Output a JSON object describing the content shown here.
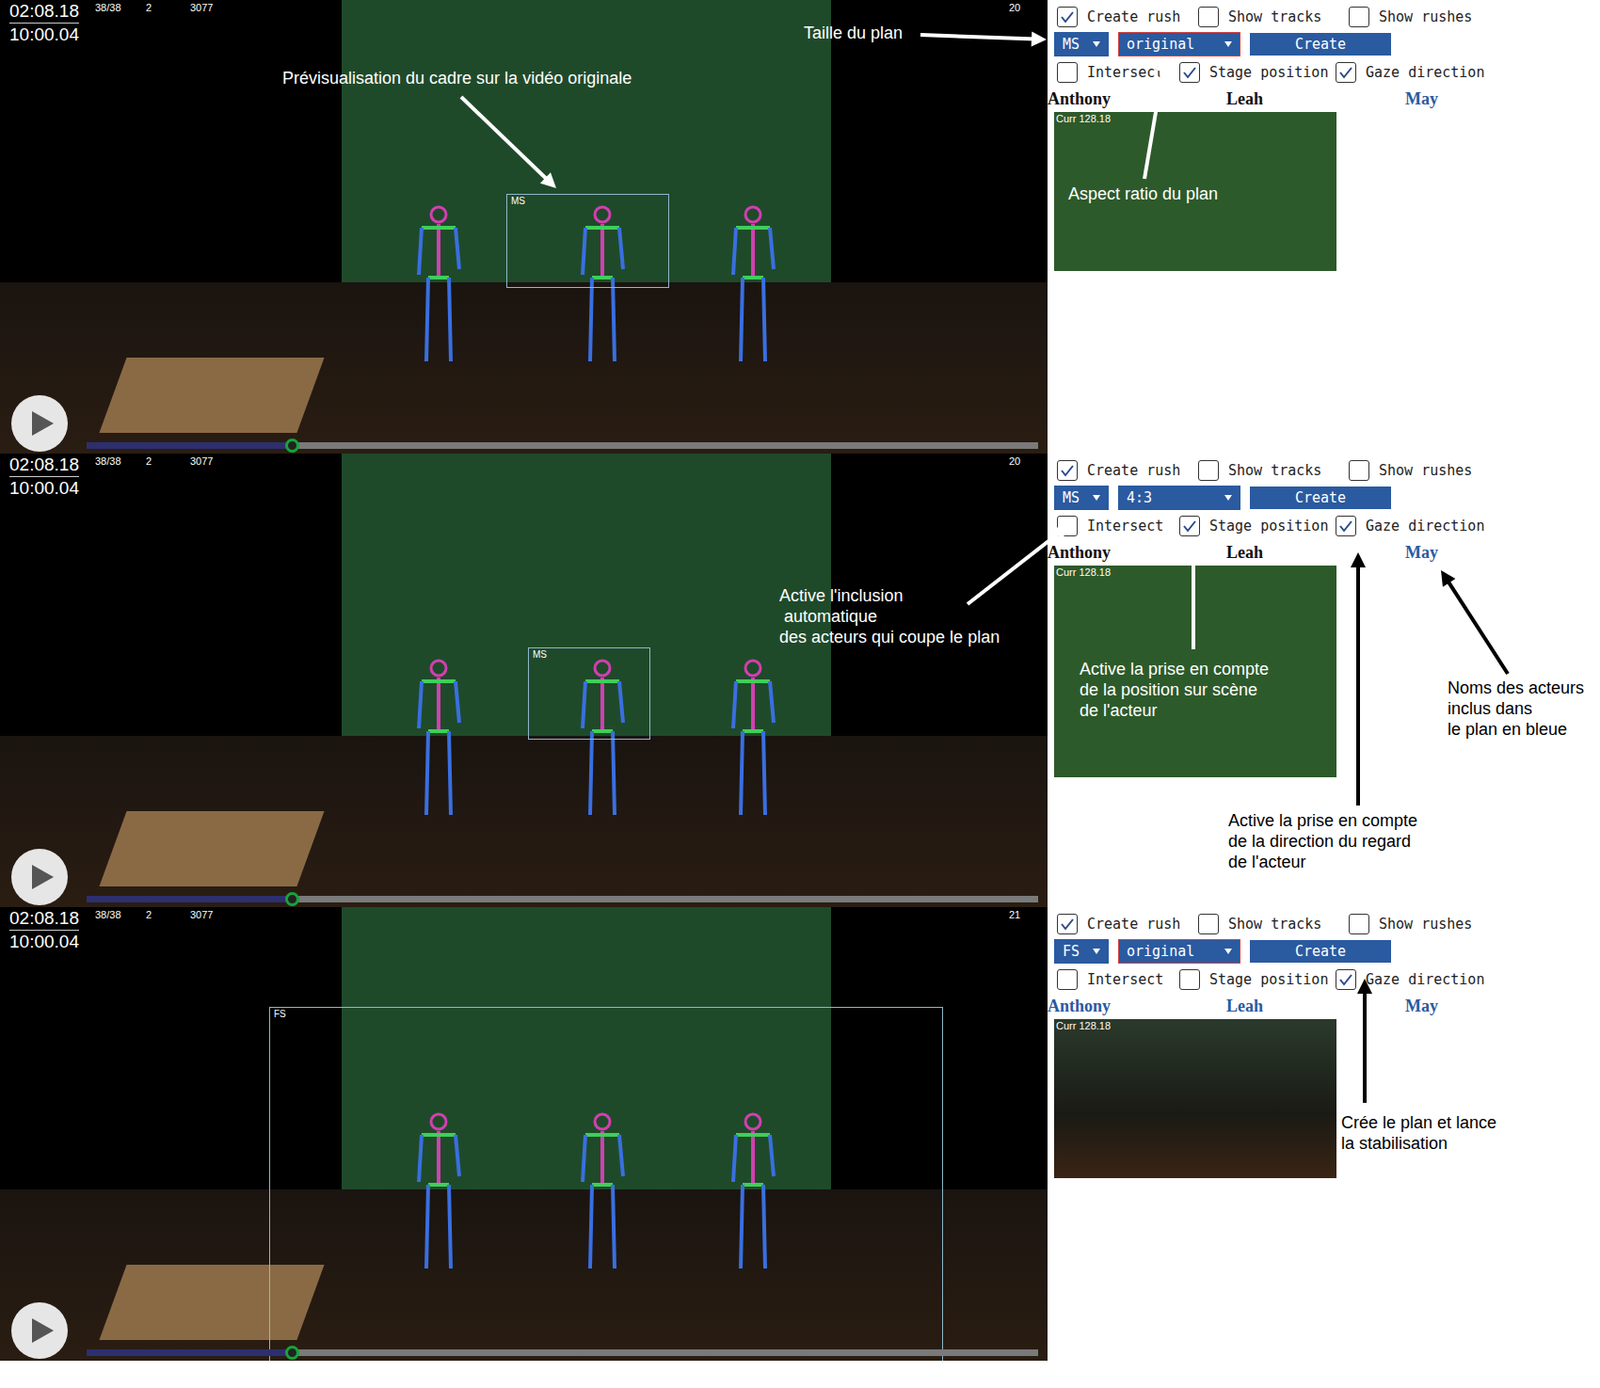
{
  "panels": [
    {
      "video": {
        "time": "02:08.18",
        "timecode": "10:00.04",
        "frames": "38/38",
        "track": "2",
        "frame_number": "3077",
        "counter": "20",
        "progress": 0.215,
        "frame_label": "MS"
      },
      "controls": {
        "top": [
          {
            "label": "Create rush",
            "checked": true
          },
          {
            "label": "Show tracks",
            "checked": false
          },
          {
            "label": "Show rushes",
            "checked": false
          }
        ],
        "shot_size": "MS",
        "aspect": "original",
        "aspect_focused": true,
        "create": "Create",
        "options": [
          {
            "label": "Intersect",
            "checked": false
          },
          {
            "label": "Stage position",
            "checked": true
          },
          {
            "label": "Gaze direction",
            "checked": true
          }
        ],
        "actors": [
          {
            "name": "Anthony",
            "included": false
          },
          {
            "name": "Leah",
            "included": false
          },
          {
            "name": "May",
            "included": true
          }
        ],
        "preview": {
          "caption": "Curr 128.18",
          "kind": "close"
        }
      }
    },
    {
      "video": {
        "time": "02:08.18",
        "timecode": "10:00.04",
        "frames": "38/38",
        "track": "2",
        "frame_number": "3077",
        "counter": "20",
        "progress": 0.215,
        "frame_label": "MS"
      },
      "controls": {
        "top": [
          {
            "label": "Create rush",
            "checked": true
          },
          {
            "label": "Show tracks",
            "checked": false
          },
          {
            "label": "Show rushes",
            "checked": false
          }
        ],
        "shot_size": "MS",
        "aspect": "4:3",
        "aspect_focused": false,
        "create": "Create",
        "options": [
          {
            "label": "Intersect",
            "checked": false
          },
          {
            "label": "Stage position",
            "checked": true
          },
          {
            "label": "Gaze direction",
            "checked": true
          }
        ],
        "actors": [
          {
            "name": "Anthony",
            "included": false
          },
          {
            "name": "Leah",
            "included": false
          },
          {
            "name": "May",
            "included": true
          }
        ],
        "preview": {
          "caption": "Curr 128.18",
          "kind": "close"
        }
      }
    },
    {
      "video": {
        "time": "02:08.18",
        "timecode": "10:00.04",
        "frames": "38/38",
        "track": "2",
        "frame_number": "3077",
        "counter": "21",
        "progress": 0.215,
        "frame_label": "FS"
      },
      "controls": {
        "top": [
          {
            "label": "Create rush",
            "checked": true
          },
          {
            "label": "Show tracks",
            "checked": false
          },
          {
            "label": "Show rushes",
            "checked": false
          }
        ],
        "shot_size": "FS",
        "aspect": "original",
        "aspect_focused": true,
        "create": "Create",
        "options": [
          {
            "label": "Intersect",
            "checked": false
          },
          {
            "label": "Stage position",
            "checked": false
          },
          {
            "label": "Gaze direction",
            "checked": true
          }
        ],
        "actors": [
          {
            "name": "Anthony",
            "included": true
          },
          {
            "name": "Leah",
            "included": true
          },
          {
            "name": "May",
            "included": true
          }
        ],
        "preview": {
          "caption": "Curr 128.18",
          "kind": "wide"
        }
      }
    }
  ],
  "annotations": [
    {
      "text": "Taille du plan",
      "color": "#ffffff"
    },
    {
      "text": "Prévisualisation du cadre sur la vidéo originale",
      "color": "#ffffff"
    },
    {
      "text": "Aspect ratio du plan",
      "color": "#ffffff"
    },
    {
      "text": "Active l'inclusion\n automatique\ndes acteurs qui coupe le plan",
      "color": "#ffffff"
    },
    {
      "text": "Active la prise en compte\nde la position sur scène\nde l'acteur",
      "color": "#ffffff"
    },
    {
      "text": "Active la prise en compte\nde la direction du regard\nde l'acteur",
      "color": "#000000"
    },
    {
      "text": "Noms des acteurs\ninclus dans\nle plan en bleue",
      "color": "#000000"
    },
    {
      "text": "Crée le plan et lance\nla stabilisation",
      "color": "#000000"
    }
  ]
}
